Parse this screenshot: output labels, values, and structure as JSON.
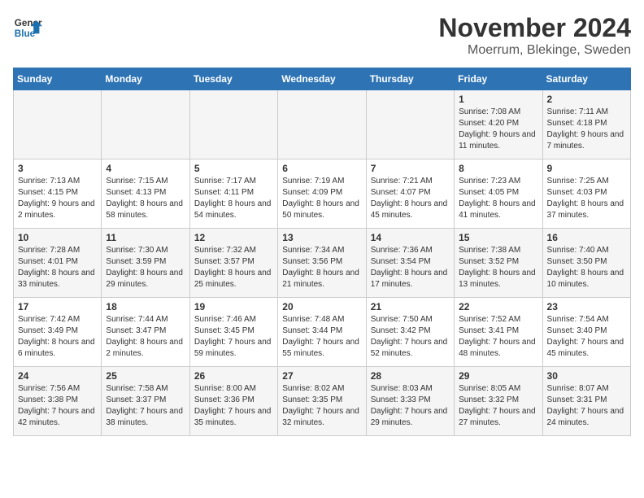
{
  "logo": {
    "line1": "General",
    "line2": "Blue"
  },
  "title": "November 2024",
  "subtitle": "Moerrum, Blekinge, Sweden",
  "header": {
    "days": [
      "Sunday",
      "Monday",
      "Tuesday",
      "Wednesday",
      "Thursday",
      "Friday",
      "Saturday"
    ]
  },
  "weeks": [
    {
      "cells": [
        {
          "day": "",
          "content": ""
        },
        {
          "day": "",
          "content": ""
        },
        {
          "day": "",
          "content": ""
        },
        {
          "day": "",
          "content": ""
        },
        {
          "day": "",
          "content": ""
        },
        {
          "day": "1",
          "content": "Sunrise: 7:08 AM\nSunset: 4:20 PM\nDaylight: 9 hours and 11 minutes."
        },
        {
          "day": "2",
          "content": "Sunrise: 7:11 AM\nSunset: 4:18 PM\nDaylight: 9 hours and 7 minutes."
        }
      ]
    },
    {
      "cells": [
        {
          "day": "3",
          "content": "Sunrise: 7:13 AM\nSunset: 4:15 PM\nDaylight: 9 hours and 2 minutes."
        },
        {
          "day": "4",
          "content": "Sunrise: 7:15 AM\nSunset: 4:13 PM\nDaylight: 8 hours and 58 minutes."
        },
        {
          "day": "5",
          "content": "Sunrise: 7:17 AM\nSunset: 4:11 PM\nDaylight: 8 hours and 54 minutes."
        },
        {
          "day": "6",
          "content": "Sunrise: 7:19 AM\nSunset: 4:09 PM\nDaylight: 8 hours and 50 minutes."
        },
        {
          "day": "7",
          "content": "Sunrise: 7:21 AM\nSunset: 4:07 PM\nDaylight: 8 hours and 45 minutes."
        },
        {
          "day": "8",
          "content": "Sunrise: 7:23 AM\nSunset: 4:05 PM\nDaylight: 8 hours and 41 minutes."
        },
        {
          "day": "9",
          "content": "Sunrise: 7:25 AM\nSunset: 4:03 PM\nDaylight: 8 hours and 37 minutes."
        }
      ]
    },
    {
      "cells": [
        {
          "day": "10",
          "content": "Sunrise: 7:28 AM\nSunset: 4:01 PM\nDaylight: 8 hours and 33 minutes."
        },
        {
          "day": "11",
          "content": "Sunrise: 7:30 AM\nSunset: 3:59 PM\nDaylight: 8 hours and 29 minutes."
        },
        {
          "day": "12",
          "content": "Sunrise: 7:32 AM\nSunset: 3:57 PM\nDaylight: 8 hours and 25 minutes."
        },
        {
          "day": "13",
          "content": "Sunrise: 7:34 AM\nSunset: 3:56 PM\nDaylight: 8 hours and 21 minutes."
        },
        {
          "day": "14",
          "content": "Sunrise: 7:36 AM\nSunset: 3:54 PM\nDaylight: 8 hours and 17 minutes."
        },
        {
          "day": "15",
          "content": "Sunrise: 7:38 AM\nSunset: 3:52 PM\nDaylight: 8 hours and 13 minutes."
        },
        {
          "day": "16",
          "content": "Sunrise: 7:40 AM\nSunset: 3:50 PM\nDaylight: 8 hours and 10 minutes."
        }
      ]
    },
    {
      "cells": [
        {
          "day": "17",
          "content": "Sunrise: 7:42 AM\nSunset: 3:49 PM\nDaylight: 8 hours and 6 minutes."
        },
        {
          "day": "18",
          "content": "Sunrise: 7:44 AM\nSunset: 3:47 PM\nDaylight: 8 hours and 2 minutes."
        },
        {
          "day": "19",
          "content": "Sunrise: 7:46 AM\nSunset: 3:45 PM\nDaylight: 7 hours and 59 minutes."
        },
        {
          "day": "20",
          "content": "Sunrise: 7:48 AM\nSunset: 3:44 PM\nDaylight: 7 hours and 55 minutes."
        },
        {
          "day": "21",
          "content": "Sunrise: 7:50 AM\nSunset: 3:42 PM\nDaylight: 7 hours and 52 minutes."
        },
        {
          "day": "22",
          "content": "Sunrise: 7:52 AM\nSunset: 3:41 PM\nDaylight: 7 hours and 48 minutes."
        },
        {
          "day": "23",
          "content": "Sunrise: 7:54 AM\nSunset: 3:40 PM\nDaylight: 7 hours and 45 minutes."
        }
      ]
    },
    {
      "cells": [
        {
          "day": "24",
          "content": "Sunrise: 7:56 AM\nSunset: 3:38 PM\nDaylight: 7 hours and 42 minutes."
        },
        {
          "day": "25",
          "content": "Sunrise: 7:58 AM\nSunset: 3:37 PM\nDaylight: 7 hours and 38 minutes."
        },
        {
          "day": "26",
          "content": "Sunrise: 8:00 AM\nSunset: 3:36 PM\nDaylight: 7 hours and 35 minutes."
        },
        {
          "day": "27",
          "content": "Sunrise: 8:02 AM\nSunset: 3:35 PM\nDaylight: 7 hours and 32 minutes."
        },
        {
          "day": "28",
          "content": "Sunrise: 8:03 AM\nSunset: 3:33 PM\nDaylight: 7 hours and 29 minutes."
        },
        {
          "day": "29",
          "content": "Sunrise: 8:05 AM\nSunset: 3:32 PM\nDaylight: 7 hours and 27 minutes."
        },
        {
          "day": "30",
          "content": "Sunrise: 8:07 AM\nSunset: 3:31 PM\nDaylight: 7 hours and 24 minutes."
        }
      ]
    }
  ]
}
